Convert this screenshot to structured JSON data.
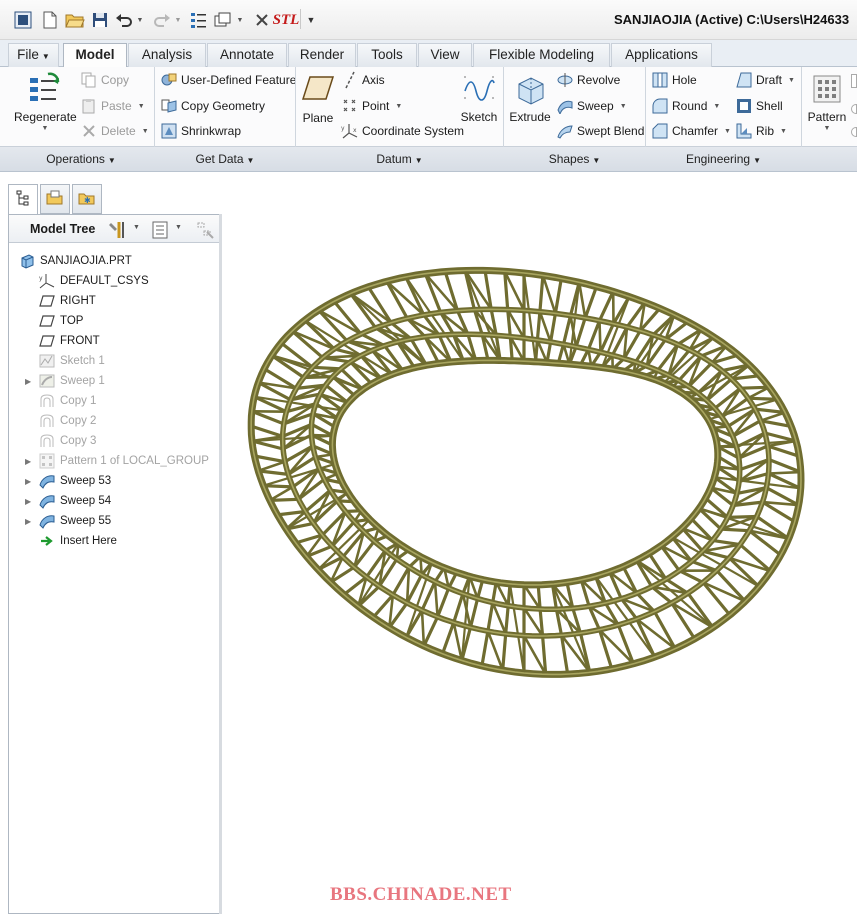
{
  "window": {
    "title": "SANJIAOJIA (Active) C:\\Users\\H24633",
    "quick_access": [
      "new-icon",
      "open-icon",
      "save-icon",
      "undo-icon",
      "redo-icon",
      "regenerate-icon",
      "windows-icon",
      "close-icon",
      "stl-icon",
      "customize-icon"
    ],
    "stl_label": "STL"
  },
  "tabs": [
    {
      "label": "File",
      "active": false
    },
    {
      "label": "Model",
      "active": true
    },
    {
      "label": "Analysis",
      "active": false
    },
    {
      "label": "Annotate",
      "active": false
    },
    {
      "label": "Render",
      "active": false
    },
    {
      "label": "Tools",
      "active": false
    },
    {
      "label": "View",
      "active": false
    },
    {
      "label": "Flexible Modeling",
      "active": false
    },
    {
      "label": "Applications",
      "active": false
    }
  ],
  "ribbon": {
    "operations": {
      "label": "Operations",
      "regenerate": "Regenerate",
      "copy": "Copy",
      "paste": "Paste",
      "delete": "Delete"
    },
    "get_data": {
      "label": "Get Data",
      "user_defined_feature": "User-Defined Feature",
      "copy_geometry": "Copy Geometry",
      "shrinkwrap": "Shrinkwrap"
    },
    "datum": {
      "label": "Datum",
      "plane": "Plane",
      "axis": "Axis",
      "point": "Point",
      "coordinate_system": "Coordinate System",
      "sketch": "Sketch"
    },
    "shapes": {
      "label": "Shapes",
      "extrude": "Extrude",
      "revolve": "Revolve",
      "sweep": "Sweep",
      "swept_blend": "Swept Blend"
    },
    "engineering": {
      "label": "Engineering",
      "hole": "Hole",
      "round": "Round",
      "chamfer": "Chamfer",
      "draft": "Draft",
      "shell": "Shell",
      "rib": "Rib"
    },
    "editing": {
      "pattern": "Pattern"
    }
  },
  "model_tree": {
    "title": "Model Tree",
    "items": [
      {
        "label": "SANJIAOJIA.PRT",
        "icon": "part-icon",
        "dim": false,
        "expandable": false
      },
      {
        "label": "DEFAULT_CSYS",
        "icon": "csys-icon",
        "dim": false,
        "expandable": false
      },
      {
        "label": "RIGHT",
        "icon": "datum-plane-icon",
        "dim": false,
        "expandable": false
      },
      {
        "label": "TOP",
        "icon": "datum-plane-icon",
        "dim": false,
        "expandable": false
      },
      {
        "label": "FRONT",
        "icon": "datum-plane-icon",
        "dim": false,
        "expandable": false
      },
      {
        "label": "Sketch 1",
        "icon": "sketch-icon",
        "dim": true,
        "expandable": false
      },
      {
        "label": "Sweep 1",
        "icon": "sweep-icon",
        "dim": true,
        "expandable": true
      },
      {
        "label": "Copy 1",
        "icon": "copy-feature-icon",
        "dim": true,
        "expandable": false
      },
      {
        "label": "Copy 2",
        "icon": "copy-feature-icon",
        "dim": true,
        "expandable": false
      },
      {
        "label": "Copy 3",
        "icon": "copy-feature-icon",
        "dim": true,
        "expandable": false
      },
      {
        "label": "Pattern 1 of LOCAL_GROUP",
        "icon": "pattern-icon",
        "dim": true,
        "expandable": true
      },
      {
        "label": "Sweep 53",
        "icon": "sweep-icon",
        "dim": false,
        "expandable": true
      },
      {
        "label": "Sweep 54",
        "icon": "sweep-icon",
        "dim": false,
        "expandable": true
      },
      {
        "label": "Sweep 55",
        "icon": "sweep-icon",
        "dim": false,
        "expandable": true
      },
      {
        "label": "Insert Here",
        "icon": "insert-arrow-icon",
        "dim": false,
        "expandable": false
      }
    ]
  },
  "watermark": "BBS.CHINADE.NET",
  "colors": {
    "model": "#6f6c30",
    "model_highlight": "#a8a560",
    "watermark": "#e8767f",
    "accent": "#2a6fb5"
  }
}
